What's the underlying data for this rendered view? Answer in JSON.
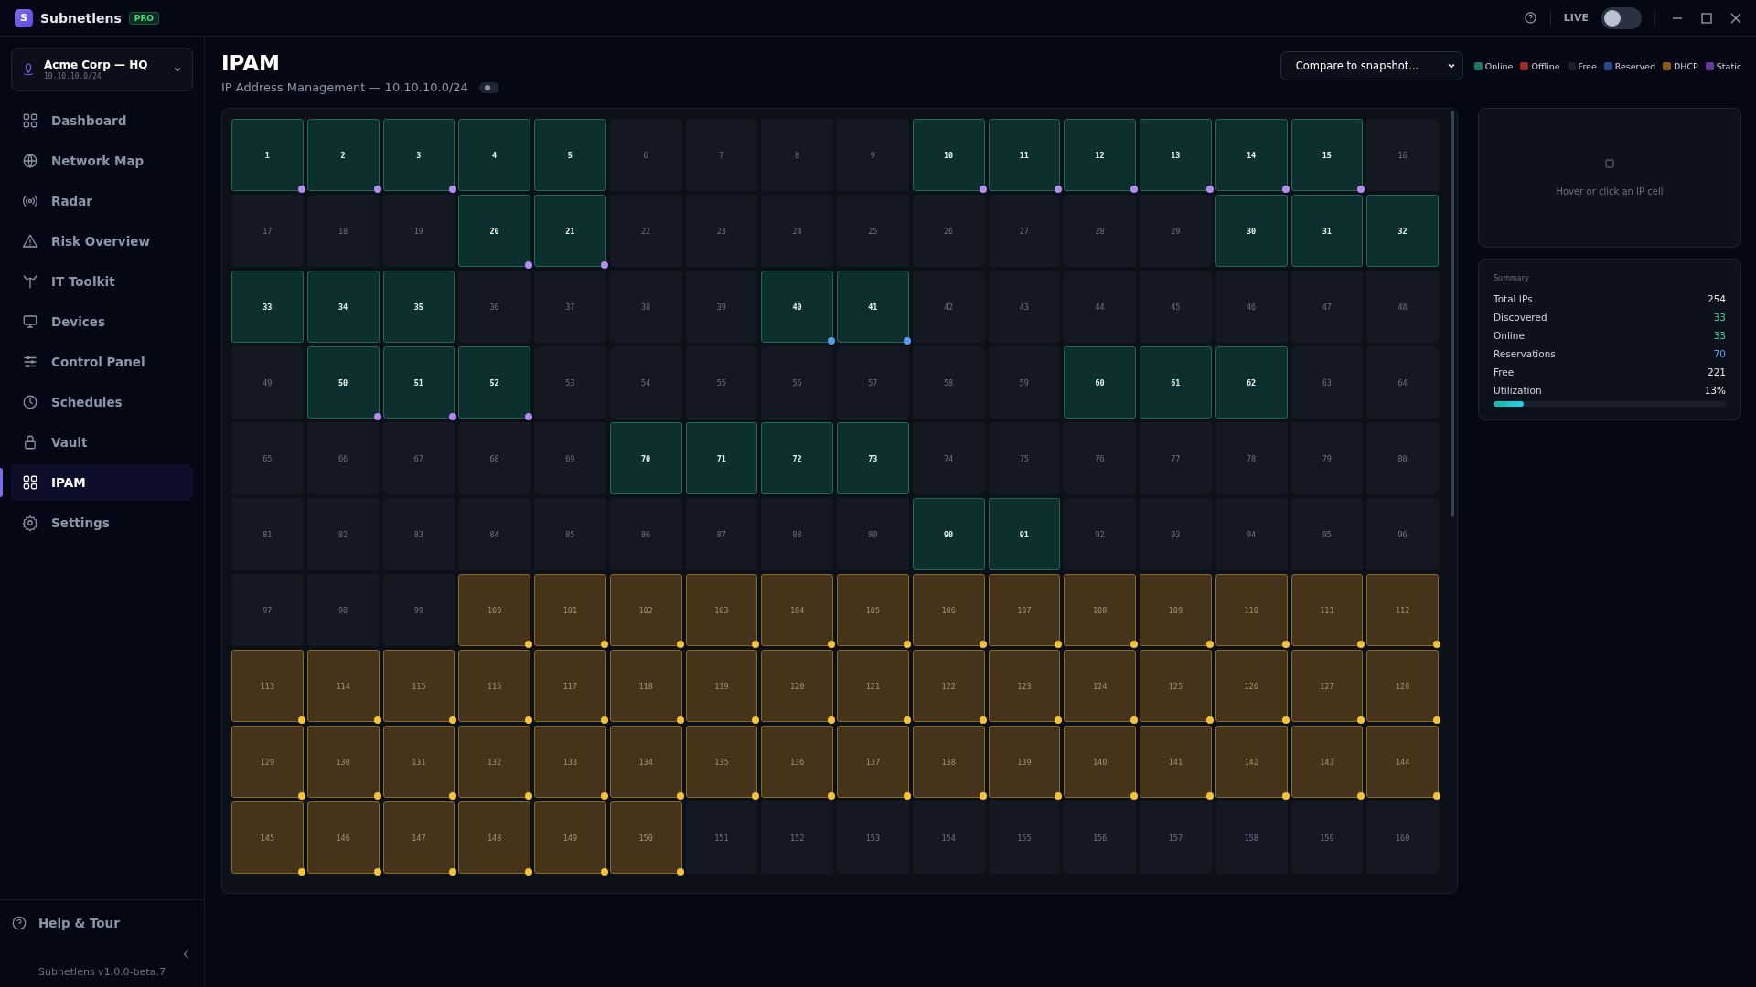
{
  "app": {
    "logo": "S",
    "name": "Subnetlens",
    "badge": "PRO"
  },
  "topbar": {
    "live_label": "LIVE",
    "live": {
      "on": false
    }
  },
  "workspace": {
    "name": "Acme Corp — HQ",
    "subnet": "10.10.10.0/24"
  },
  "nav": [
    {
      "label": "Dashboard",
      "selected": false
    },
    {
      "label": "Network Map",
      "selected": false
    },
    {
      "label": "Radar",
      "selected": false
    },
    {
      "label": "Risk Overview",
      "selected": false
    },
    {
      "label": "IT Toolkit",
      "selected": false
    },
    {
      "label": "Devices",
      "selected": false
    },
    {
      "label": "Control Panel",
      "selected": false
    },
    {
      "label": "Schedules",
      "selected": false
    },
    {
      "label": "Vault",
      "selected": false
    },
    {
      "label": "IPAM",
      "selected": true
    },
    {
      "label": "Settings",
      "selected": false
    }
  ],
  "sidebar_footer": {
    "help": "Help & Tour",
    "version": "Subnetlens v1.0.0-beta.7"
  },
  "page": {
    "title": "IPAM",
    "subtitle": "IP Address Management — 10.10.10.0/24",
    "subtitle_toggle": {
      "on": false
    }
  },
  "snapshot_select": {
    "value": "Compare to snapshot..."
  },
  "legend": [
    {
      "label": "Online",
      "color": "#1f7a5c"
    },
    {
      "label": "Offline",
      "color": "#9b2c2c"
    },
    {
      "label": "Free",
      "color": "#1a1f2e"
    },
    {
      "label": "Reserved",
      "color": "#2b4a8a"
    },
    {
      "label": "DHCP",
      "color": "#8a5a1e"
    },
    {
      "label": "Static",
      "color": "#6a3a9a"
    }
  ],
  "cells": [
    {
      "label": "1",
      "kind": "online",
      "color": "#b58cf0"
    },
    {
      "label": "2",
      "kind": "online",
      "color": "#b58cf0"
    },
    {
      "label": "3",
      "kind": "online",
      "color": "#b58cf0"
    },
    {
      "label": "4",
      "kind": "online"
    },
    {
      "label": "5",
      "kind": "online"
    },
    {
      "label": "6",
      "kind": "free"
    },
    {
      "label": "7",
      "kind": "free"
    },
    {
      "label": "8",
      "kind": "free"
    },
    {
      "label": "9",
      "kind": "free"
    },
    {
      "label": "10",
      "kind": "online",
      "color": "#b58cf0"
    },
    {
      "label": "11",
      "kind": "online",
      "color": "#b58cf0"
    },
    {
      "label": "12",
      "kind": "online",
      "color": "#b58cf0"
    },
    {
      "label": "13",
      "kind": "online",
      "color": "#b58cf0"
    },
    {
      "label": "14",
      "kind": "online",
      "color": "#b58cf0"
    },
    {
      "label": "15",
      "kind": "online",
      "color": "#b58cf0"
    },
    {
      "label": "16",
      "kind": "free"
    },
    {
      "label": "17",
      "kind": "free"
    },
    {
      "label": "18",
      "kind": "free"
    },
    {
      "label": "19",
      "kind": "free"
    },
    {
      "label": "20",
      "kind": "online",
      "color": "#b58cf0"
    },
    {
      "label": "21",
      "kind": "online",
      "color": "#b58cf0"
    },
    {
      "label": "22",
      "kind": "free"
    },
    {
      "label": "23",
      "kind": "free"
    },
    {
      "label": "24",
      "kind": "free"
    },
    {
      "label": "25",
      "kind": "free"
    },
    {
      "label": "26",
      "kind": "free"
    },
    {
      "label": "27",
      "kind": "free"
    },
    {
      "label": "28",
      "kind": "free"
    },
    {
      "label": "29",
      "kind": "free"
    },
    {
      "label": "30",
      "kind": "online"
    },
    {
      "label": "31",
      "kind": "online"
    },
    {
      "label": "32",
      "kind": "online"
    },
    {
      "label": "33",
      "kind": "online"
    },
    {
      "label": "34",
      "kind": "online"
    },
    {
      "label": "35",
      "kind": "online"
    },
    {
      "label": "36",
      "kind": "free"
    },
    {
      "label": "37",
      "kind": "free"
    },
    {
      "label": "38",
      "kind": "free"
    },
    {
      "label": "39",
      "kind": "free"
    },
    {
      "label": "40",
      "kind": "online",
      "color": "#5b9cf0"
    },
    {
      "label": "41",
      "kind": "online",
      "color": "#5b9cf0"
    },
    {
      "label": "42",
      "kind": "free"
    },
    {
      "label": "43",
      "kind": "free"
    },
    {
      "label": "44",
      "kind": "free"
    },
    {
      "label": "45",
      "kind": "free"
    },
    {
      "label": "46",
      "kind": "free"
    },
    {
      "label": "47",
      "kind": "free"
    },
    {
      "label": "48",
      "kind": "free"
    },
    {
      "label": "49",
      "kind": "free"
    },
    {
      "label": "50",
      "kind": "online",
      "color": "#b58cf0"
    },
    {
      "label": "51",
      "kind": "online",
      "color": "#b58cf0"
    },
    {
      "label": "52",
      "kind": "online",
      "color": "#b58cf0"
    },
    {
      "label": "53",
      "kind": "free"
    },
    {
      "label": "54",
      "kind": "free"
    },
    {
      "label": "55",
      "kind": "free"
    },
    {
      "label": "56",
      "kind": "free"
    },
    {
      "label": "57",
      "kind": "free"
    },
    {
      "label": "58",
      "kind": "free"
    },
    {
      "label": "59",
      "kind": "free"
    },
    {
      "label": "60",
      "kind": "online"
    },
    {
      "label": "61",
      "kind": "online"
    },
    {
      "label": "62",
      "kind": "online"
    },
    {
      "label": "63",
      "kind": "free"
    },
    {
      "label": "64",
      "kind": "free"
    },
    {
      "label": "65",
      "kind": "free"
    },
    {
      "label": "66",
      "kind": "free"
    },
    {
      "label": "67",
      "kind": "free"
    },
    {
      "label": "68",
      "kind": "free"
    },
    {
      "label": "69",
      "kind": "free"
    },
    {
      "label": "70",
      "kind": "online"
    },
    {
      "label": "71",
      "kind": "online"
    },
    {
      "label": "72",
      "kind": "online"
    },
    {
      "label": "73",
      "kind": "online"
    },
    {
      "label": "74",
      "kind": "free"
    },
    {
      "label": "75",
      "kind": "free"
    },
    {
      "label": "76",
      "kind": "free"
    },
    {
      "label": "77",
      "kind": "free"
    },
    {
      "label": "78",
      "kind": "free"
    },
    {
      "label": "79",
      "kind": "free"
    },
    {
      "label": "80",
      "kind": "free"
    },
    {
      "label": "81",
      "kind": "free"
    },
    {
      "label": "82",
      "kind": "free"
    },
    {
      "label": "83",
      "kind": "free"
    },
    {
      "label": "84",
      "kind": "free"
    },
    {
      "label": "85",
      "kind": "free"
    },
    {
      "label": "86",
      "kind": "free"
    },
    {
      "label": "87",
      "kind": "free"
    },
    {
      "label": "88",
      "kind": "free"
    },
    {
      "label": "89",
      "kind": "free"
    },
    {
      "label": "90",
      "kind": "online"
    },
    {
      "label": "91",
      "kind": "online"
    },
    {
      "label": "92",
      "kind": "free"
    },
    {
      "label": "93",
      "kind": "free"
    },
    {
      "label": "94",
      "kind": "free"
    },
    {
      "label": "95",
      "kind": "free"
    },
    {
      "label": "96",
      "kind": "free"
    },
    {
      "label": "97",
      "kind": "free"
    },
    {
      "label": "98",
      "kind": "free"
    },
    {
      "label": "99",
      "kind": "free"
    },
    {
      "label": "100",
      "kind": "dhcp",
      "color": "#f5c33b"
    },
    {
      "label": "101",
      "kind": "dhcp",
      "color": "#f5c33b"
    },
    {
      "label": "102",
      "kind": "dhcp",
      "color": "#f5c33b"
    },
    {
      "label": "103",
      "kind": "dhcp",
      "color": "#f5c33b"
    },
    {
      "label": "104",
      "kind": "dhcp",
      "color": "#f5c33b"
    },
    {
      "label": "105",
      "kind": "dhcp",
      "color": "#f5c33b"
    },
    {
      "label": "106",
      "kind": "dhcp",
      "color": "#f5c33b"
    },
    {
      "label": "107",
      "kind": "dhcp",
      "color": "#f5c33b"
    },
    {
      "label": "108",
      "kind": "dhcp",
      "color": "#f5c33b"
    },
    {
      "label": "109",
      "kind": "dhcp",
      "color": "#f5c33b"
    },
    {
      "label": "110",
      "kind": "dhcp",
      "color": "#f5c33b"
    },
    {
      "label": "111",
      "kind": "dhcp",
      "color": "#f5c33b"
    },
    {
      "label": "112",
      "kind": "dhcp",
      "color": "#f5c33b"
    },
    {
      "label": "113",
      "kind": "dhcp",
      "color": "#f5c33b"
    },
    {
      "label": "114",
      "kind": "dhcp",
      "color": "#f5c33b"
    },
    {
      "label": "115",
      "kind": "dhcp",
      "color": "#f5c33b"
    },
    {
      "label": "116",
      "kind": "dhcp",
      "color": "#f5c33b"
    },
    {
      "label": "117",
      "kind": "dhcp",
      "color": "#f5c33b"
    },
    {
      "label": "118",
      "kind": "dhcp",
      "color": "#f5c33b"
    },
    {
      "label": "119",
      "kind": "dhcp",
      "color": "#f5c33b"
    },
    {
      "label": "120",
      "kind": "dhcp",
      "color": "#f5c33b"
    },
    {
      "label": "121",
      "kind": "dhcp",
      "color": "#f5c33b"
    },
    {
      "label": "122",
      "kind": "dhcp",
      "color": "#f5c33b"
    },
    {
      "label": "123",
      "kind": "dhcp",
      "color": "#f5c33b"
    },
    {
      "label": "124",
      "kind": "dhcp",
      "color": "#f5c33b"
    },
    {
      "label": "125",
      "kind": "dhcp",
      "color": "#f5c33b"
    },
    {
      "label": "126",
      "kind": "dhcp",
      "color": "#f5c33b"
    },
    {
      "label": "127",
      "kind": "dhcp",
      "color": "#f5c33b"
    },
    {
      "label": "128",
      "kind": "dhcp",
      "color": "#f5c33b"
    },
    {
      "label": "129",
      "kind": "dhcp",
      "color": "#f5c33b"
    },
    {
      "label": "130",
      "kind": "dhcp",
      "color": "#f5c33b"
    },
    {
      "label": "131",
      "kind": "dhcp",
      "color": "#f5c33b"
    },
    {
      "label": "132",
      "kind": "dhcp",
      "color": "#f5c33b"
    },
    {
      "label": "133",
      "kind": "dhcp",
      "color": "#f5c33b"
    },
    {
      "label": "134",
      "kind": "dhcp",
      "color": "#f5c33b"
    },
    {
      "label": "135",
      "kind": "dhcp",
      "color": "#f5c33b"
    },
    {
      "label": "136",
      "kind": "dhcp",
      "color": "#f5c33b"
    },
    {
      "label": "137",
      "kind": "dhcp",
      "color": "#f5c33b"
    },
    {
      "label": "138",
      "kind": "dhcp",
      "color": "#f5c33b"
    },
    {
      "label": "139",
      "kind": "dhcp",
      "color": "#f5c33b"
    },
    {
      "label": "140",
      "kind": "dhcp",
      "color": "#f5c33b"
    },
    {
      "label": "141",
      "kind": "dhcp",
      "color": "#f5c33b"
    },
    {
      "label": "142",
      "kind": "dhcp",
      "color": "#f5c33b"
    },
    {
      "label": "143",
      "kind": "dhcp",
      "color": "#f5c33b"
    },
    {
      "label": "144",
      "kind": "dhcp",
      "color": "#f5c33b"
    },
    {
      "label": "145",
      "kind": "dhcp",
      "color": "#f5c33b"
    },
    {
      "label": "146",
      "kind": "dhcp",
      "color": "#f5c33b"
    },
    {
      "label": "147",
      "kind": "dhcp",
      "color": "#f5c33b"
    },
    {
      "label": "148",
      "kind": "dhcp",
      "color": "#f5c33b"
    },
    {
      "label": "149",
      "kind": "dhcp",
      "color": "#f5c33b"
    },
    {
      "label": "150",
      "kind": "dhcp",
      "color": "#f5c33b"
    },
    {
      "label": "151",
      "kind": "free"
    },
    {
      "label": "152",
      "kind": "free"
    },
    {
      "label": "153",
      "kind": "free"
    },
    {
      "label": "154",
      "kind": "free"
    },
    {
      "label": "155",
      "kind": "free"
    },
    {
      "label": "156",
      "kind": "free"
    },
    {
      "label": "157",
      "kind": "free"
    },
    {
      "label": "158",
      "kind": "free"
    },
    {
      "label": "159",
      "kind": "free"
    },
    {
      "label": "160",
      "kind": "free"
    }
  ],
  "detail_panel": {
    "hint": "Hover or click an IP cell"
  },
  "summary": {
    "title": "Summary",
    "rows": [
      {
        "label": "Total IPs",
        "value": "254",
        "color": "#e5e7eb"
      },
      {
        "label": "Discovered",
        "value": "33",
        "color": "#34d399"
      },
      {
        "label": "Online",
        "value": "33",
        "color": "#34d399"
      },
      {
        "label": "Reservations",
        "value": "70",
        "color": "#60a5fa"
      },
      {
        "label": "Free",
        "value": "221",
        "color": "#e5e7eb"
      },
      {
        "label": "Utilization",
        "value": "13%",
        "color": "#e5e7eb"
      }
    ],
    "utilization": {
      "level": 0.13
    }
  }
}
